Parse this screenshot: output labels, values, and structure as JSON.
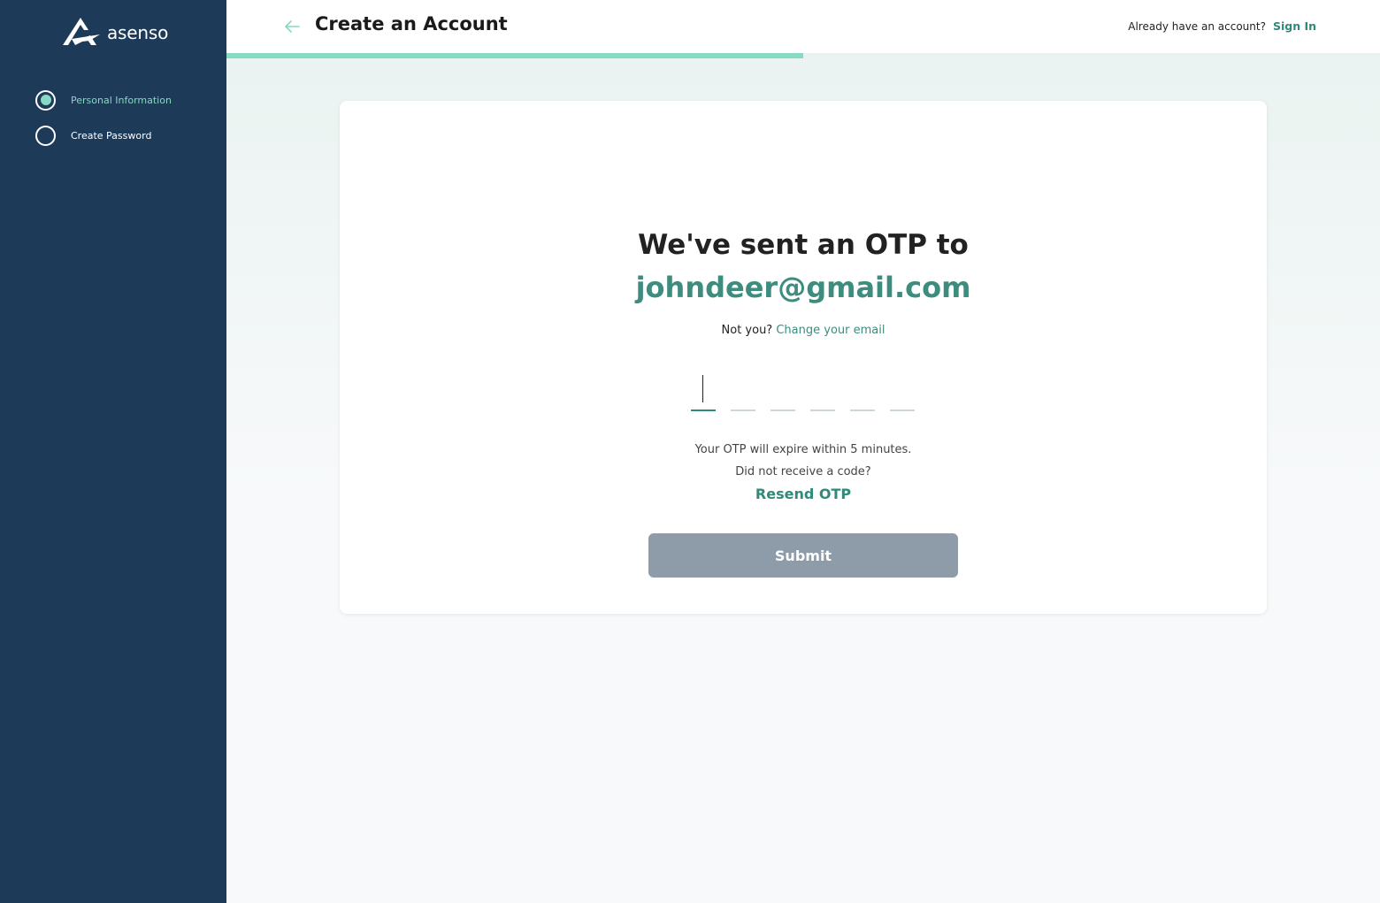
{
  "brand": {
    "name": "asenso",
    "logo_icon": "asenso-mountain-logo"
  },
  "sidebar": {
    "steps": [
      {
        "label": "Personal Information",
        "active": true
      },
      {
        "label": "Create Password",
        "active": false
      }
    ]
  },
  "header": {
    "title": "Create an Account",
    "back_icon": "arrow-left-icon",
    "already_text": "Already have an account?",
    "signin_label": "Sign In"
  },
  "progress": {
    "fraction": 0.5,
    "color": "#86d9c2"
  },
  "otp": {
    "headline": "We've sent an OTP to",
    "email": "johndeer@gmail.com",
    "not_you": "Not you?",
    "change_email_label": "Change your email",
    "digits": [
      "",
      "",
      "",
      "",
      "",
      ""
    ],
    "expire_text": "Your OTP will expire within 5 minutes.",
    "no_code_text": "Did not receive a code?",
    "resend_label": "Resend OTP",
    "submit_label": "Submit"
  },
  "colors": {
    "sidebar": "#1d3a59",
    "accent": "#3d8c7e",
    "accent_light": "#86d9c2",
    "submit_disabled": "#8e9caa"
  }
}
